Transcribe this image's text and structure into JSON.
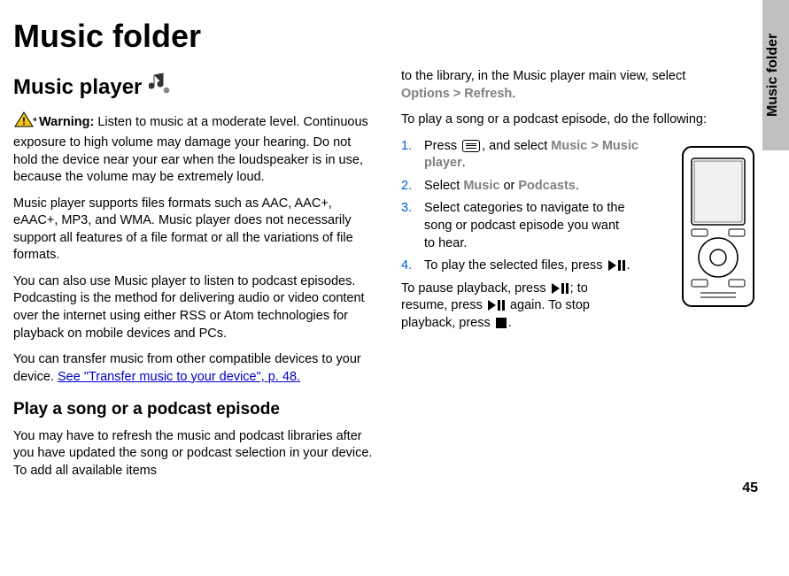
{
  "sideTab": "Music folder",
  "pageTitle": "Music folder",
  "pageNumber": "45",
  "section1": {
    "title": "Music player",
    "warningLabel": "Warning:",
    "warningText": " Listen to music at a moderate level. Continuous exposure to high volume may damage your hearing. Do not hold the device near your ear when the loudspeaker is in use, because the volume may be extremely loud.",
    "p2": "Music player supports files formats such as AAC, AAC+, eAAC+, MP3, and WMA. Music player does not necessarily support all features of a file format or all the variations of file formats.",
    "p3": "You can also use Music player to listen to podcast episodes. Podcasting is the method for delivering audio or video content over the internet using either RSS or Atom technologies for playback on mobile devices and PCs.",
    "p4a": "You can transfer music from other compatible devices to your device. ",
    "p4link": "See \"Transfer music to your device\", p. 48."
  },
  "section2": {
    "title": "Play a song or a podcast episode",
    "p1": "You may have to refresh the music and podcast libraries after you have updated the song or podcast selection in your device. To add all available items",
    "p1cont": "to the library, in the Music player main view, select ",
    "menuOptions": "Options",
    "menuSep": ">",
    "menuRefresh": "Refresh",
    "p2": "To play a song or a podcast episode, do the following:",
    "step1a": "Press ",
    "step1b": ", and select ",
    "step1Music": "Music",
    "step1Player": "Music player",
    "step2a": "Select ",
    "step2Music": "Music",
    "step2or": " or ",
    "step2Podcasts": "Podcasts",
    "step3": "Select categories to navigate to the song or podcast episode you want to hear.",
    "step4a": "To play the selected files, press ",
    "playbackA": "To pause playback, press ",
    "playbackB": "; to resume, press ",
    "playbackC": " again. To stop playback, press "
  }
}
